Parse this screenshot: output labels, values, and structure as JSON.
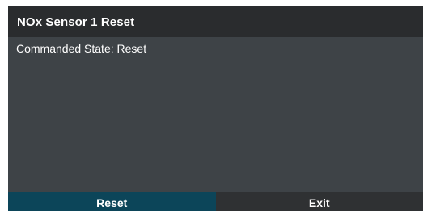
{
  "dialog": {
    "title": "NOx Sensor 1 Reset",
    "message": "Commanded State: Reset"
  },
  "buttons": {
    "reset_label": "Reset",
    "exit_label": "Exit"
  },
  "colors": {
    "title_bar": "#2a2c2e",
    "body": "#3e4347",
    "reset_button": "#0c4559",
    "exit_button": "#2f3133",
    "text": "#ffffff"
  }
}
